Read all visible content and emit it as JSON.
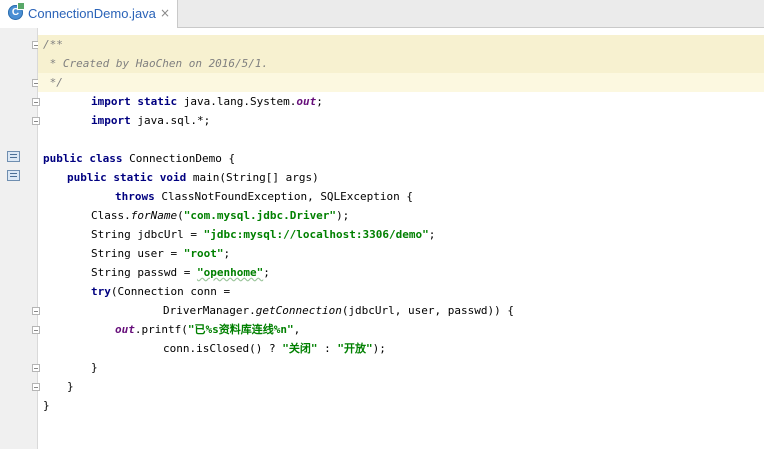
{
  "tab": {
    "title": "ConnectionDemo.java",
    "icon": "java-class-icon",
    "close": "×"
  },
  "colors": {
    "keyword": "#000080",
    "string": "#008000",
    "comment": "#808080",
    "field": "#660e7a",
    "doc_highlight": "#f7f1d0",
    "tab_text": "#2a63b8"
  },
  "code": {
    "l1": {
      "t": "/**"
    },
    "l2": {
      "t": " * Created by HaoChen on 2016/5/1."
    },
    "l3": {
      "t": " */"
    },
    "l4": {
      "kw1": "import",
      "kw2": "static",
      "t1": " java.lang.System.",
      "f": "out",
      "t2": ";"
    },
    "l5": {
      "kw": "import",
      "t": " java.sql.*;"
    },
    "l7": {
      "kw1": "public",
      "kw2": "class",
      "t": " ConnectionDemo {"
    },
    "l8": {
      "kw1": "public",
      "kw2": "static",
      "kw3": "void",
      "t": " main(String[] args)"
    },
    "l9": {
      "kw": "throws",
      "t": " ClassNotFoundException, SQLException {"
    },
    "l10": {
      "t1": "Class.",
      "m": "forName",
      "t2": "(",
      "s": "\"com.mysql.jdbc.Driver\"",
      "t3": ");"
    },
    "l11": {
      "t1": "String jdbcUrl = ",
      "s": "\"jdbc:mysql://localhost:3306/demo\"",
      "t2": ";"
    },
    "l12": {
      "t1": "String user = ",
      "s": "\"root\"",
      "t2": ";"
    },
    "l13": {
      "t1": "String passwd = ",
      "s": "\"openhome\"",
      "t2": ";"
    },
    "l14": {
      "kw": "try",
      "t": "(Connection conn ="
    },
    "l15": {
      "t1": "DriverManager.",
      "m": "getConnection",
      "t2": "(jdbcUrl, user, passwd)) {"
    },
    "l16": {
      "f": "out",
      "t1": ".printf(",
      "s": "\"已%s资料库连线%n\"",
      "t2": ","
    },
    "l17": {
      "t1": "conn.isClosed() ? ",
      "s1": "\"关闭\"",
      "t2": " : ",
      "s2": "\"开放\"",
      "t3": ");"
    },
    "l18": {
      "t": "}"
    },
    "l19": {
      "t": "}"
    },
    "l20": {
      "t": "}"
    }
  }
}
